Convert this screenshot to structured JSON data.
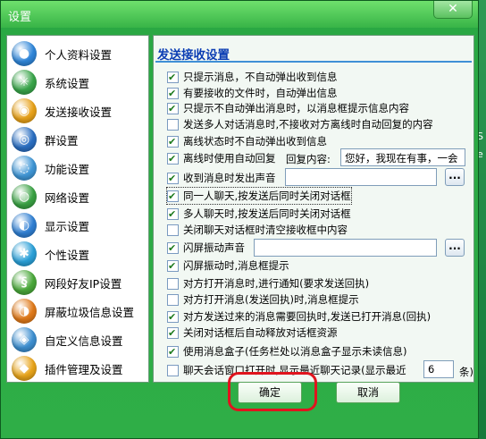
{
  "window": {
    "title": "设置",
    "close_label": "✕"
  },
  "desktop": {
    "side_text_1": "S",
    "side_text_2": "e"
  },
  "sidebar": {
    "items": [
      {
        "label": "个人资料设置",
        "icon": "profile-icon",
        "color": "#2f86d9"
      },
      {
        "label": "系统设置",
        "icon": "system-icon",
        "color": "#39a54a"
      },
      {
        "label": "发送接收设置",
        "icon": "send-receive-icon",
        "color": "#e8a21a"
      },
      {
        "label": "群设置",
        "icon": "group-icon",
        "color": "#2b6fc2"
      },
      {
        "label": "功能设置",
        "icon": "function-icon",
        "color": "#3f96d6"
      },
      {
        "label": "网络设置",
        "icon": "network-icon",
        "color": "#3aa244"
      },
      {
        "label": "显示设置",
        "icon": "display-icon",
        "color": "#2f7fd3"
      },
      {
        "label": "个性设置",
        "icon": "personal-icon",
        "color": "#2aa0d8"
      },
      {
        "label": "网段好友IP设置",
        "icon": "ip-icon",
        "color": "#4aa83a"
      },
      {
        "label": "屏蔽垃圾信息设置",
        "icon": "block-spam-icon",
        "color": "#e07a1a"
      },
      {
        "label": "自定义信息设置",
        "icon": "custom-info-icon",
        "color": "#3d8fd0"
      },
      {
        "label": "插件管理及设置",
        "icon": "plugin-icon",
        "color": "#e8a41a"
      }
    ]
  },
  "panel": {
    "title": "发送接收设置",
    "options": [
      {
        "label": "只提示消息，不自动弹出收到信息",
        "checked": true
      },
      {
        "label": "有要接收的文件时，自动弹出信息",
        "checked": true
      },
      {
        "label": "只提示不自动弹出消息时，以消息框提示信息内容",
        "checked": true
      },
      {
        "label": "发送多人对话消息时,不接收对方离线时自动回复的内容",
        "checked": false
      },
      {
        "label": "离线状态时不自动弹出收到信息",
        "checked": true
      },
      {
        "label": "离线时使用自动回复",
        "checked": true
      },
      {
        "label": "收到消息时发出声音",
        "checked": true
      },
      {
        "label": "同一人聊天,按发送后同时关闭对话框",
        "checked": true
      },
      {
        "label": "多人聊天时,按发送后同时关闭对话框",
        "checked": true
      },
      {
        "label": "关闭聊天对话框时清空接收框中内容",
        "checked": false
      },
      {
        "label": "闪屏振动声音",
        "checked": true
      },
      {
        "label": "闪屏振动时,消息框提示",
        "checked": true
      },
      {
        "label": "对方打开消息时,进行通知(要求发送回执)",
        "checked": false
      },
      {
        "label": "对方打开消息(发送回执)时,消息框提示",
        "checked": false
      },
      {
        "label": "对方发送过来的消息需要回执时,发送已打开消息(回执)",
        "checked": true
      },
      {
        "label": "关闭对话框后自动释放对话框资源",
        "checked": true
      },
      {
        "label": "使用消息盒子(任务栏处以消息盒子显示未读信息)",
        "checked": true
      },
      {
        "label": "聊天会话窗口打开时,显示最近聊天记录(显示最近",
        "checked": false
      }
    ],
    "reply_label": "回复内容:",
    "reply_value": "您好，我现在有事，一会",
    "sound_path": "",
    "flash_sound_path": "",
    "browse_label": "...",
    "recent_count": "6",
    "recent_suffix": "条)"
  },
  "buttons": {
    "ok": "确定",
    "cancel": "取消"
  }
}
